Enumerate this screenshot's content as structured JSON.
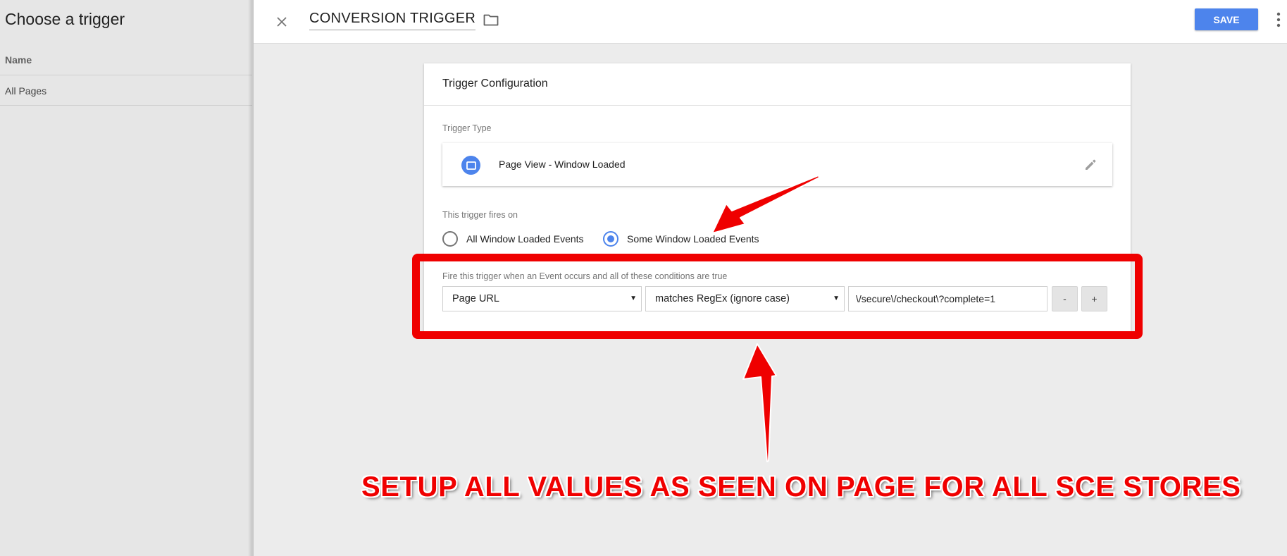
{
  "sidebar": {
    "title": "Choose a trigger",
    "column_header": "Name",
    "items": [
      {
        "label": "All Pages"
      }
    ]
  },
  "topbar": {
    "close_icon": "close-icon",
    "trigger_name": "CONVERSION TRIGGER",
    "folder_icon": "folder-icon",
    "save_label": "SAVE",
    "more_icon": "more-vert-icon"
  },
  "card": {
    "title": "Trigger Configuration",
    "trigger_type_label": "Trigger Type",
    "trigger_type": "Page View - Window Loaded",
    "type_icon": "window-icon",
    "edit_icon": "pencil-icon",
    "fires_on_label": "This trigger fires on",
    "fires_on_options": [
      {
        "label": "All Window Loaded Events",
        "selected": false
      },
      {
        "label": "Some Window Loaded Events",
        "selected": true
      }
    ],
    "conditions_label": "Fire this trigger when an Event occurs and all of these conditions are true",
    "condition": {
      "variable": "Page URL",
      "operator": "matches RegEx (ignore case)",
      "value": "\\/secure\\/checkout\\?complete=1",
      "remove_label": "-",
      "add_label": "+"
    }
  },
  "annotation": {
    "caption": "SETUP ALL VALUES AS SEEN ON PAGE FOR ALL SCE STORES",
    "color": "#ef0000"
  },
  "colors": {
    "accent": "#4d84ec",
    "annotation": "#ef0000",
    "sidebar_bg": "#e6e6e6",
    "content_bg": "#ececec"
  }
}
